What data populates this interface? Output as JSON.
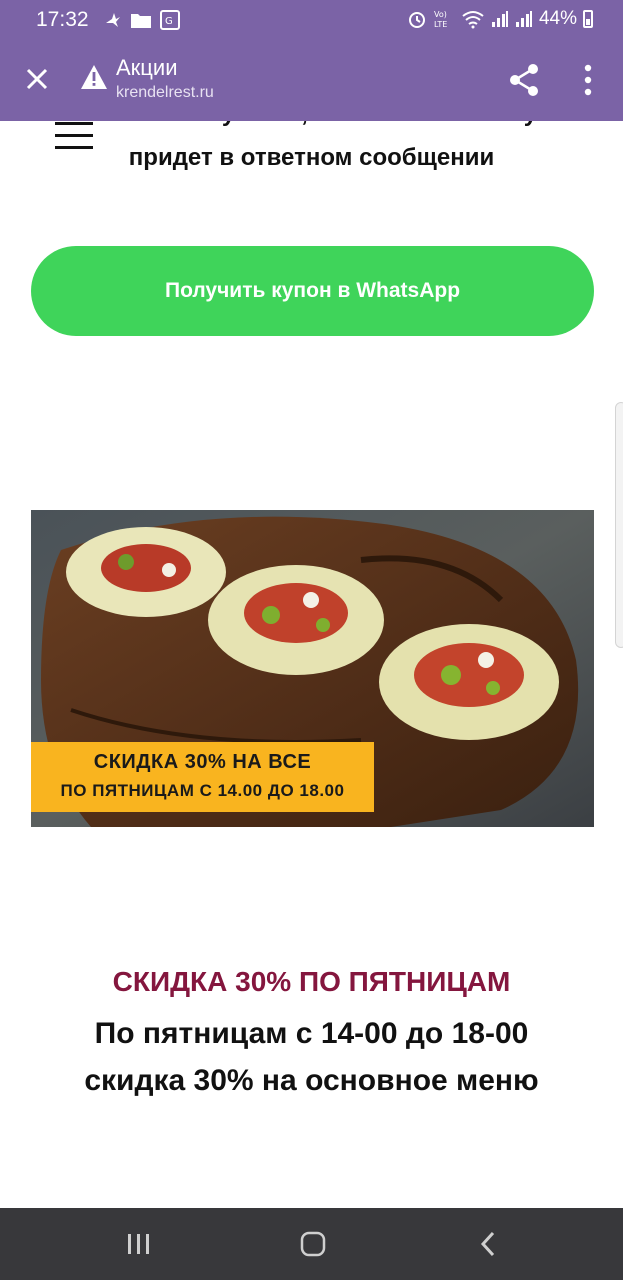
{
  "status_bar": {
    "time": "17:32",
    "battery": "44%",
    "icons": [
      "bird-icon",
      "folder-icon",
      "translate-icon",
      "alarm-icon",
      "volte-icon",
      "wifi-icon",
      "signal-icon",
      "signal-icon",
      "battery-icon"
    ]
  },
  "app_bar": {
    "title": "Акции",
    "url": "krendelrest.ru",
    "icons": [
      "close-icon",
      "warning-icon",
      "share-icon",
      "more-vert-icon"
    ]
  },
  "page": {
    "intro_text": "Нажмите кнопку ниже, напишите нам и купон придет в ответном сообщении",
    "whatsapp_button": "Получить купон в WhatsApp",
    "banner_line1": "СКИДКА 30% НА ВСЕ",
    "banner_line2": "ПО ПЯТНИЦАМ С 14.00 ДО 18.00",
    "promo_heading": "СКИДКА 30% ПО ПЯТНИЦАМ",
    "promo_description": "По пятницам с 14-00 до 18-00 скидка 30% на основное меню"
  },
  "colors": {
    "app_bar": "#7b63a6",
    "whatsapp_button": "#3fd45a",
    "banner": "#f9b41f",
    "promo_heading": "#84163e",
    "nav_bar": "#38383b"
  },
  "nav_bar": {
    "icons": [
      "recent-apps-icon",
      "home-icon",
      "back-icon"
    ]
  }
}
